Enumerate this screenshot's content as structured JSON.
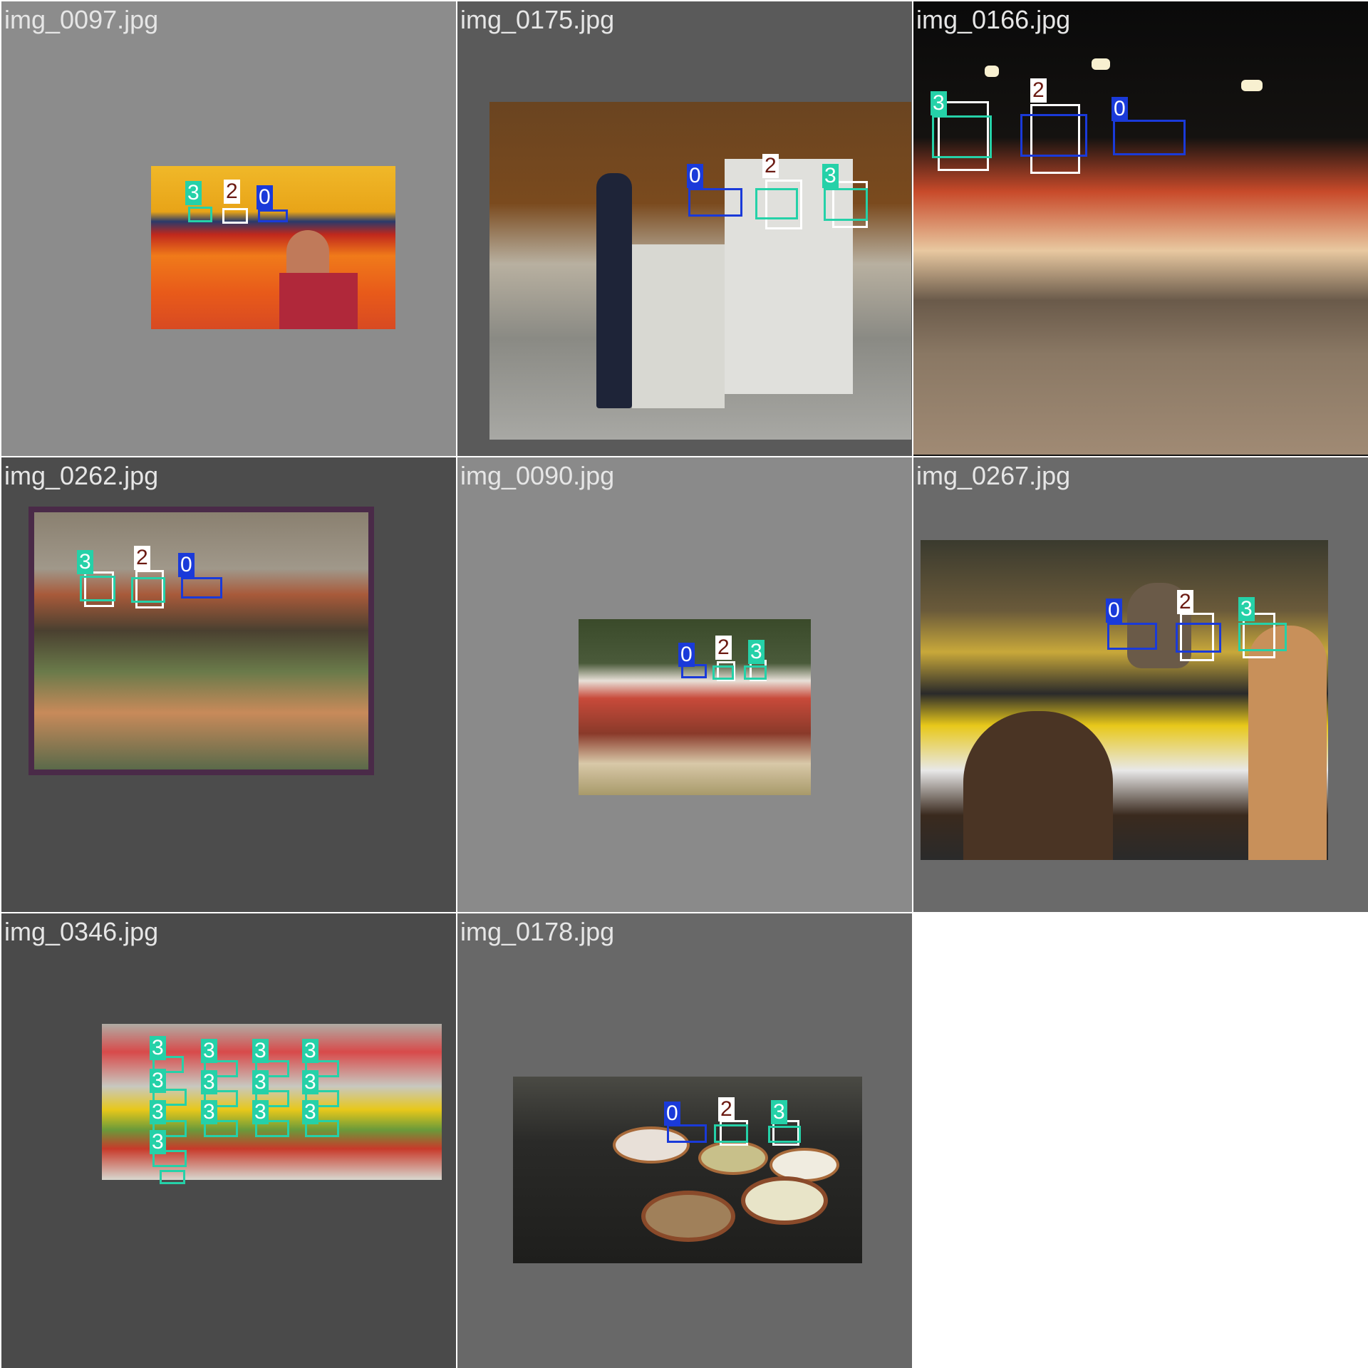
{
  "mosaic": {
    "tiles": [
      {
        "filename": "img_0097.jpg",
        "tile_bg": "#8c8c8c",
        "scene": "fruit-stand-bananas-oranges-vendor",
        "palette": [
          "#f0b829",
          "#f07a1a",
          "#c0281c",
          "#3a5a2a"
        ],
        "detections": [
          {
            "cls": "3"
          },
          {
            "cls": "2"
          },
          {
            "cls": "0"
          }
        ]
      },
      {
        "filename": "img_0175.jpg",
        "tile_bg": "#5a5a5a",
        "scene": "kitchen-woman-open-refrigerator",
        "palette": [
          "#7a4a1e",
          "#c8c8c0",
          "#2a2a2a",
          "#e8e8e8"
        ],
        "detections": [
          {
            "cls": "0"
          },
          {
            "cls": "2"
          },
          {
            "cls": "3"
          }
        ]
      },
      {
        "filename": "img_0166.jpg",
        "tile_bg": "#141414",
        "scene": "night-market-stall-lights",
        "palette": [
          "#0a0a0a",
          "#d2482a",
          "#f2d080",
          "#8a7a6a"
        ],
        "detections": [
          {
            "cls": "3"
          },
          {
            "cls": "2"
          },
          {
            "cls": "0"
          }
        ]
      },
      {
        "filename": "img_0262.jpg",
        "tile_bg": "#4c4c4c",
        "scene": "outdoor-vegetable-market-awning",
        "palette": [
          "#5a4a62",
          "#a85a3a",
          "#4a6a3a",
          "#8a8a7a"
        ],
        "detections": [
          {
            "cls": "3"
          },
          {
            "cls": "2"
          },
          {
            "cls": "0"
          }
        ]
      },
      {
        "filename": "img_0090.jpg",
        "tile_bg": "#8a8a8a",
        "scene": "market-table-jars-cider",
        "palette": [
          "#3a4a2a",
          "#a83a2a",
          "#e8d8c8",
          "#6a2a1a"
        ],
        "detections": [
          {
            "cls": "0"
          },
          {
            "cls": "2"
          },
          {
            "cls": "3"
          }
        ]
      },
      {
        "filename": "img_0267.jpg",
        "tile_bg": "#6a6a6a",
        "scene": "juice-stand-crowd",
        "palette": [
          "#3a2a1e",
          "#f2c81a",
          "#e8e8e8",
          "#2a3a2a"
        ],
        "detections": [
          {
            "cls": "0"
          },
          {
            "cls": "2"
          },
          {
            "cls": "3"
          }
        ]
      },
      {
        "filename": "img_0346.jpg",
        "tile_bg": "#4a4a4a",
        "scene": "fridge-shelves-fruit-containers",
        "palette": [
          "#c8c8c0",
          "#e8c81a",
          "#c83a2a",
          "#6a9a3a"
        ],
        "detections": [
          {
            "cls": "3"
          },
          {
            "cls": "3"
          },
          {
            "cls": "3"
          },
          {
            "cls": "3"
          },
          {
            "cls": "3"
          },
          {
            "cls": "3"
          },
          {
            "cls": "3"
          },
          {
            "cls": "3"
          },
          {
            "cls": "3"
          },
          {
            "cls": "3"
          },
          {
            "cls": "3"
          },
          {
            "cls": "3"
          },
          {
            "cls": "3"
          },
          {
            "cls": "3"
          },
          {
            "cls": "3"
          }
        ]
      },
      {
        "filename": "img_0178.jpg",
        "tile_bg": "#686868",
        "scene": "buffet-bowls-on-marble-table",
        "palette": [
          "#2a2a2a",
          "#f0f0e8",
          "#a86a3a",
          "#c8c08a"
        ],
        "detections": [
          {
            "cls": "0"
          },
          {
            "cls": "2"
          },
          {
            "cls": "3"
          }
        ]
      }
    ]
  }
}
